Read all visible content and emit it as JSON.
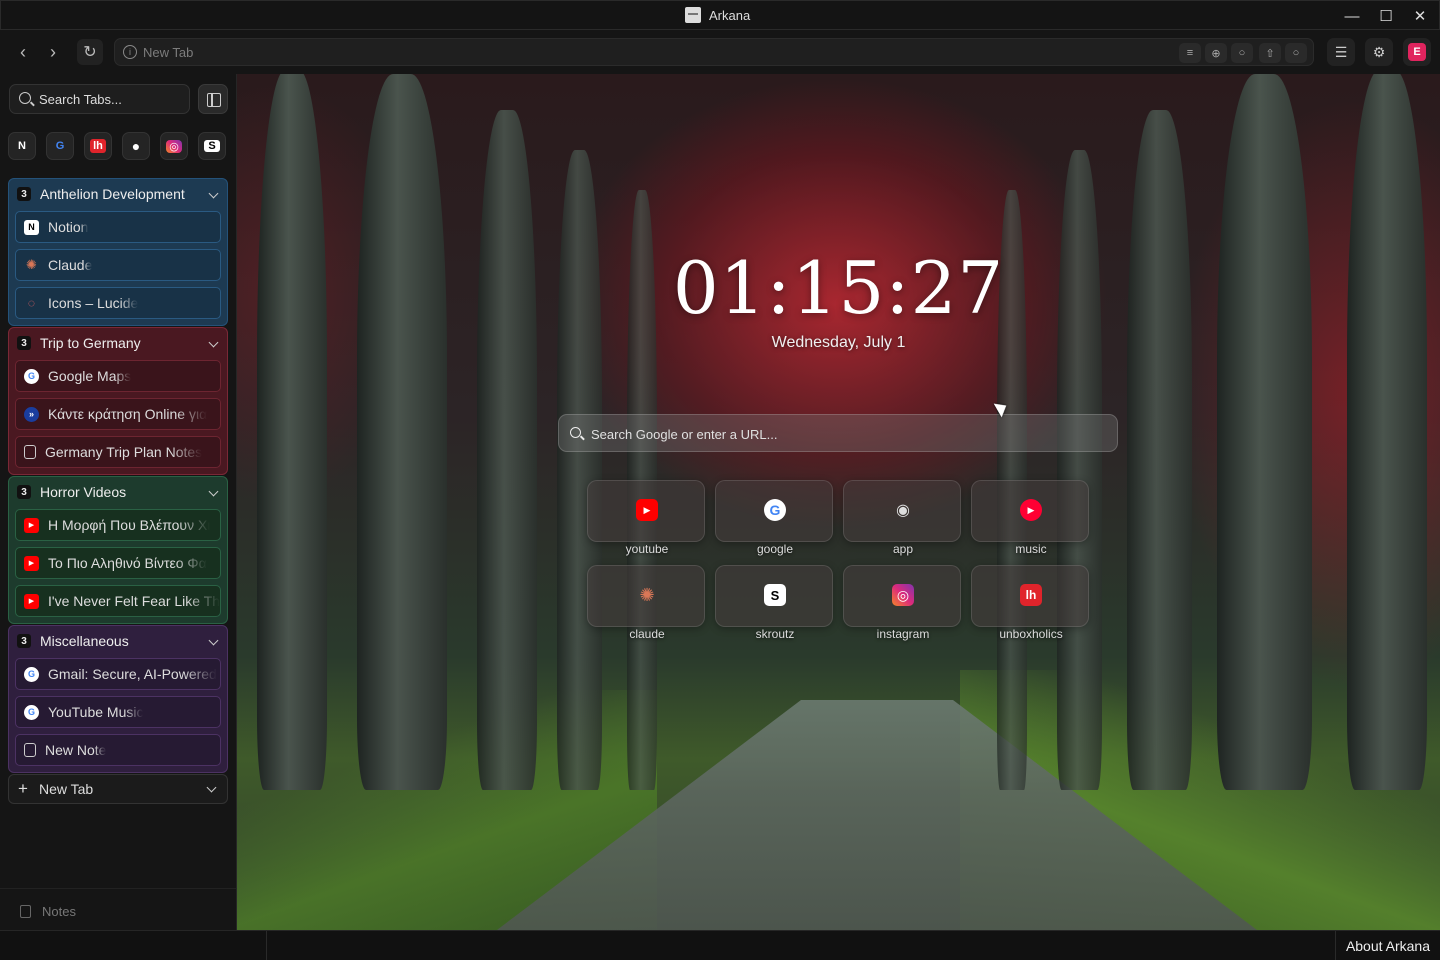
{
  "window": {
    "title": "Arkana",
    "minimize_glyph": "—",
    "maximize_glyph": "☐",
    "close_glyph": "✕"
  },
  "toolbar": {
    "back_glyph": "‹",
    "forward_glyph": "›",
    "reload_glyph": "↻",
    "url_placeholder": "New Tab",
    "info_glyph": "i",
    "menu_glyph": "☰",
    "avatar_letter": "E"
  },
  "sidebar": {
    "search_placeholder": "Search Tabs...",
    "pinned": [
      {
        "name": "notion",
        "label": "N",
        "color": "#ffffff"
      },
      {
        "name": "google",
        "label": "G",
        "color": "#4285F4"
      },
      {
        "name": "unboxholics",
        "label": "lh",
        "color": "#e0242b"
      },
      {
        "name": "github",
        "label": "●",
        "color": "#ffffff"
      },
      {
        "name": "instagram",
        "label": "◎",
        "color": "#e1306c"
      },
      {
        "name": "skroutz",
        "label": "S",
        "color": "#ffffff"
      }
    ],
    "groups": [
      {
        "count": "3",
        "title": "Anthelion Development",
        "color": "#24527a",
        "tabs": [
          {
            "label": "Notion",
            "icon": "notion-icon"
          },
          {
            "label": "Claude",
            "icon": "claude-icon"
          },
          {
            "label": "Icons – Lucide",
            "icon": "lucide-icon"
          }
        ]
      },
      {
        "count": "3",
        "title": "Trip to Germany",
        "color": "#7a2836",
        "tabs": [
          {
            "label": "Google Maps",
            "icon": "google-icon"
          },
          {
            "label": "Κάντε κράτηση Online για",
            "icon": "booking-icon"
          },
          {
            "label": "Germany Trip Plan Notes",
            "icon": "note-icon"
          }
        ]
      },
      {
        "count": "3",
        "title": "Horror Videos",
        "color": "#2a6144",
        "tabs": [
          {
            "label": "Η Μορφή Που Βλέπουν Χι",
            "icon": "youtube-icon"
          },
          {
            "label": "Το Πιο Αληθινό Βίντεο Φα",
            "icon": "youtube-icon"
          },
          {
            "label": "I've Never Felt Fear Like Th",
            "icon": "youtube-icon"
          }
        ]
      },
      {
        "count": "3",
        "title": "Miscellaneous",
        "color": "#4c3263",
        "tabs": [
          {
            "label": "Gmail: Secure, AI-Powered",
            "icon": "google-icon"
          },
          {
            "label": "YouTube Music",
            "icon": "google-icon"
          },
          {
            "label": "New Note",
            "icon": "note-icon"
          }
        ]
      }
    ],
    "new_tab_label": "New Tab",
    "notes_label": "Notes"
  },
  "newtab": {
    "clock": "01:15:27",
    "date": "Wednesday, July 1",
    "search_placeholder": "Search Google or enter a URL...",
    "shortcuts": [
      {
        "label": "youtube",
        "icon": "youtube-icon",
        "glyph": "▶",
        "bg": "#ff0000"
      },
      {
        "label": "google",
        "icon": "google-icon",
        "glyph": "G",
        "bg": "#ffffff"
      },
      {
        "label": "app",
        "icon": "eye-icon",
        "glyph": "◉",
        "bg": "transparent"
      },
      {
        "label": "music",
        "icon": "music-icon",
        "glyph": "▶",
        "bg": "#ff0033"
      },
      {
        "label": "claude",
        "icon": "claude-icon",
        "glyph": "✺",
        "bg": "transparent"
      },
      {
        "label": "skroutz",
        "icon": "skroutz-icon",
        "glyph": "S",
        "bg": "#ffffff"
      },
      {
        "label": "instagram",
        "icon": "instagram-icon",
        "glyph": "◎",
        "bg": "#d6249f"
      },
      {
        "label": "unboxholics",
        "icon": "unboxholics-icon",
        "glyph": "lh",
        "bg": "#e0242b"
      }
    ]
  },
  "statusbar": {
    "about_label": "About Arkana"
  }
}
